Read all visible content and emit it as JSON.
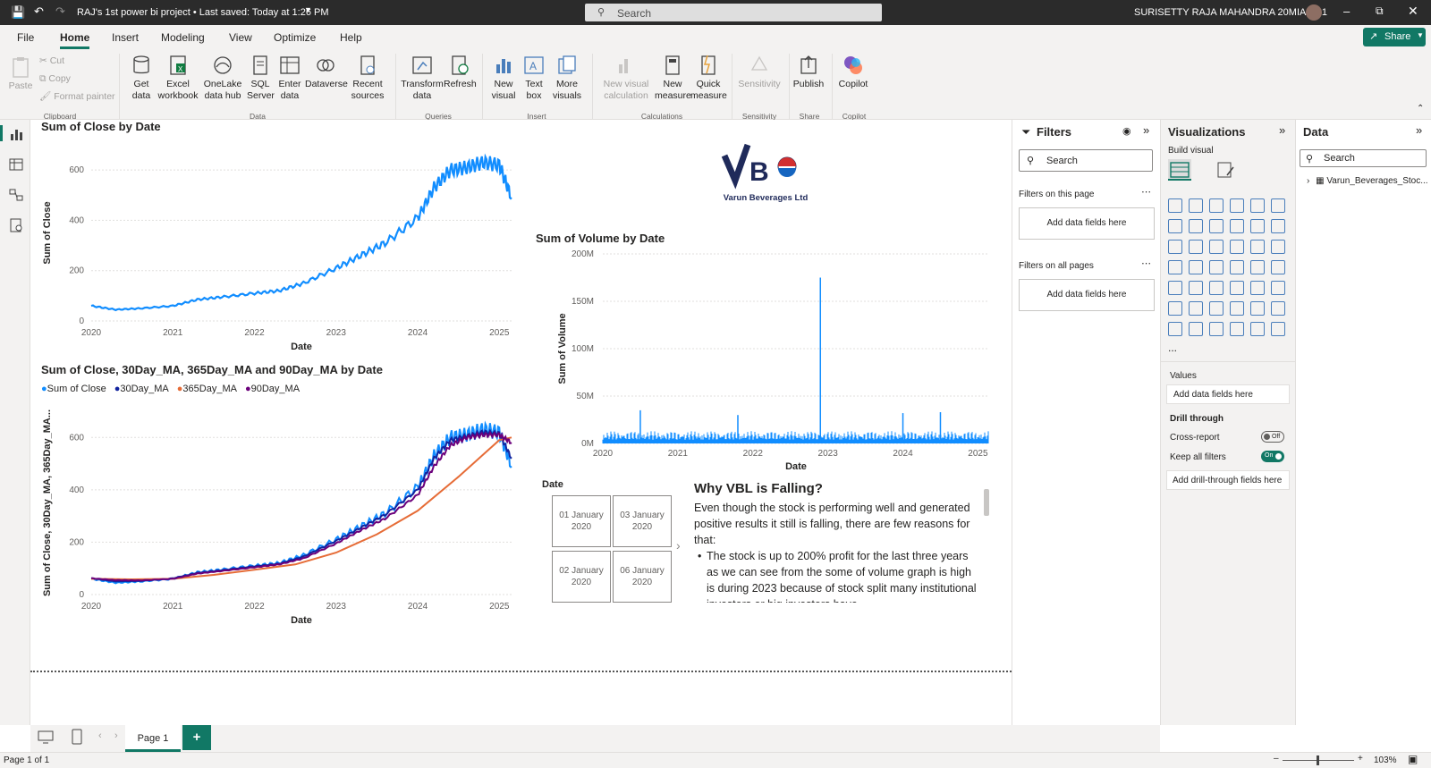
{
  "titlebar": {
    "doc_title": "RAJ's 1st power bi project • Last saved: Today at 1:26 PM",
    "search_placeholder": "Search",
    "user": "SURISETTY RAJA MAHANDRA 20MIA1161"
  },
  "menu": [
    "File",
    "Home",
    "Insert",
    "Modeling",
    "View",
    "Optimize",
    "Help"
  ],
  "share_label": "Share",
  "ribbon": {
    "clipboard": {
      "paste": "Paste",
      "cut": "Cut",
      "copy": "Copy",
      "format_painter": "Format painter",
      "group": "Clipboard"
    },
    "data": {
      "get_data": [
        "Get",
        "data"
      ],
      "excel": [
        "Excel",
        "workbook"
      ],
      "onelake": [
        "OneLake",
        "data hub"
      ],
      "sql": [
        "SQL",
        "Server"
      ],
      "enter": [
        "Enter",
        "data"
      ],
      "dataverse": "Dataverse",
      "recent": [
        "Recent",
        "sources"
      ],
      "group": "Data"
    },
    "queries": {
      "transform": [
        "Transform",
        "data"
      ],
      "refresh": "Refresh",
      "group": "Queries"
    },
    "insert": {
      "new_visual": [
        "New",
        "visual"
      ],
      "text_box": [
        "Text",
        "box"
      ],
      "more_visuals": [
        "More",
        "visuals"
      ],
      "group": "Insert"
    },
    "calculations": {
      "new_visual_calc": [
        "New visual",
        "calculation"
      ],
      "new_measure": [
        "New",
        "measure"
      ],
      "quick_measure": [
        "Quick",
        "measure"
      ],
      "group": "Calculations"
    },
    "sensitivity": {
      "label": "Sensitivity",
      "group": "Sensitivity"
    },
    "share": {
      "publish": "Publish",
      "group": "Share"
    },
    "copilot": {
      "label": "Copilot",
      "group": "Copilot"
    }
  },
  "chart1_title": "Sum of Close by Date",
  "chart2_title": "Sum of Close, 30Day_MA, 365Day_MA and 90Day_MA by Date",
  "chart3_title": "Sum of Volume by Date",
  "logo_text": "Varun Beverages Ltd",
  "chart_data": [
    {
      "type": "line",
      "title": "Sum of Close by Date",
      "xlabel": "Date",
      "ylabel": "Sum of Close",
      "x_ticks": [
        "2020",
        "2021",
        "2022",
        "2023",
        "2024",
        "2025"
      ],
      "y_ticks": [
        "0",
        "200",
        "400",
        "600"
      ],
      "ylim": [
        0,
        700
      ],
      "series": [
        {
          "color": "#118dff",
          "x": [
            2020.0,
            2020.3,
            2020.6,
            2021.0,
            2021.3,
            2021.6,
            2022.0,
            2022.3,
            2022.6,
            2023.0,
            2023.3,
            2023.6,
            2024.0,
            2024.2,
            2024.4,
            2024.6,
            2024.8,
            2025.0,
            2025.15
          ],
          "values": [
            60,
            45,
            50,
            60,
            85,
            95,
            110,
            120,
            150,
            210,
            260,
            310,
            410,
            530,
            600,
            610,
            630,
            620,
            490
          ]
        }
      ]
    },
    {
      "type": "line",
      "title": "Sum of Close, 30Day_MA, 365Day_MA and 90Day_MA by Date",
      "xlabel": "Date",
      "ylabel": "Sum of Close, 30Day_MA, 365Day_MA...",
      "x_ticks": [
        "2020",
        "2021",
        "2022",
        "2023",
        "2024",
        "2025"
      ],
      "y_ticks": [
        "0",
        "200",
        "400",
        "600"
      ],
      "ylim": [
        0,
        700
      ],
      "series": [
        {
          "name": "Sum of Close",
          "color": "#118dff",
          "x": [
            2020.0,
            2020.3,
            2020.6,
            2021.0,
            2021.3,
            2021.6,
            2022.0,
            2022.3,
            2022.6,
            2023.0,
            2023.3,
            2023.6,
            2024.0,
            2024.2,
            2024.4,
            2024.6,
            2024.8,
            2025.0,
            2025.15
          ],
          "values": [
            60,
            45,
            50,
            60,
            85,
            95,
            110,
            120,
            150,
            210,
            260,
            310,
            410,
            530,
            600,
            610,
            630,
            620,
            490
          ]
        },
        {
          "name": "30Day_MA",
          "color": "#12239e",
          "x": [
            2020.0,
            2020.3,
            2020.6,
            2021.0,
            2021.3,
            2021.6,
            2022.0,
            2022.3,
            2022.6,
            2023.0,
            2023.3,
            2023.6,
            2024.0,
            2024.2,
            2024.4,
            2024.6,
            2024.8,
            2025.0,
            2025.15
          ],
          "values": [
            62,
            50,
            52,
            62,
            83,
            93,
            108,
            118,
            145,
            205,
            255,
            305,
            400,
            520,
            590,
            605,
            620,
            615,
            520
          ]
        },
        {
          "name": "365Day_MA",
          "color": "#e66c37",
          "x": [
            2020.0,
            2020.5,
            2021.0,
            2021.5,
            2022.0,
            2022.5,
            2023.0,
            2023.5,
            2024.0,
            2024.5,
            2025.0,
            2025.15
          ],
          "values": [
            60,
            58,
            60,
            75,
            95,
            115,
            160,
            230,
            320,
            450,
            590,
            600
          ]
        },
        {
          "name": "90Day_MA",
          "color": "#6b007b",
          "x": [
            2020.0,
            2020.3,
            2020.6,
            2021.0,
            2021.3,
            2021.6,
            2022.0,
            2022.3,
            2022.6,
            2023.0,
            2023.3,
            2023.6,
            2024.0,
            2024.2,
            2024.4,
            2024.6,
            2024.8,
            2025.0,
            2025.15
          ],
          "values": [
            62,
            55,
            54,
            60,
            80,
            90,
            104,
            115,
            138,
            195,
            245,
            290,
            380,
            490,
            570,
            600,
            610,
            610,
            580
          ]
        }
      ]
    },
    {
      "type": "bar",
      "title": "Sum of Volume by Date",
      "xlabel": "Date",
      "ylabel": "Sum of Volume",
      "x_ticks": [
        "2020",
        "2021",
        "2022",
        "2023",
        "2024",
        "2025"
      ],
      "y_ticks": [
        "0M",
        "50M",
        "100M",
        "150M",
        "200M"
      ],
      "ylim": [
        0,
        200
      ],
      "series": [
        {
          "color": "#118dff",
          "spikes": [
            {
              "x": 2022.9,
              "value": 175
            },
            {
              "x": 2020.5,
              "value": 35
            },
            {
              "x": 2021.8,
              "value": 30
            },
            {
              "x": 2024.0,
              "value": 32
            },
            {
              "x": 2024.5,
              "value": 33
            }
          ]
        }
      ]
    }
  ],
  "legend": [
    "Sum of Close",
    "30Day_MA",
    "365Day_MA",
    "90Day_MA"
  ],
  "slicer": {
    "title": "Date",
    "cells": [
      [
        "01 January",
        "2020"
      ],
      [
        "03 January",
        "2020"
      ],
      [
        "02 January",
        "2020"
      ],
      [
        "06 January",
        "2020"
      ]
    ]
  },
  "textbox": {
    "heading": "Why VBL is Falling?",
    "para": "Even though the stock is performing well and generated positive results it still is falling, there are few reasons for that:",
    "bullet": "The stock is up to 200% profit for the last three years as we can see from the some of volume graph is high is during 2023 because of stock split many institutional investors or big investors have"
  },
  "filters": {
    "title": "Filters",
    "search": "Search",
    "on_page": "Filters on this page",
    "on_all": "Filters on all pages",
    "add": "Add data fields here"
  },
  "visualizations": {
    "title": "Visualizations",
    "build": "Build visual",
    "values": "Values",
    "values_add": "Add data fields here",
    "drill": "Drill through",
    "cross_report": "Cross-report",
    "cross_state": "Off",
    "keep_filters": "Keep all filters",
    "keep_state": "On",
    "drill_add": "Add drill-through fields here",
    "more": "..."
  },
  "data_pane": {
    "title": "Data",
    "search": "Search",
    "table": "Varun_Beverages_Stoc..."
  },
  "pages": {
    "tab": "Page 1",
    "add": "+"
  },
  "status": {
    "page": "Page 1 of 1",
    "zoom": "103%"
  }
}
